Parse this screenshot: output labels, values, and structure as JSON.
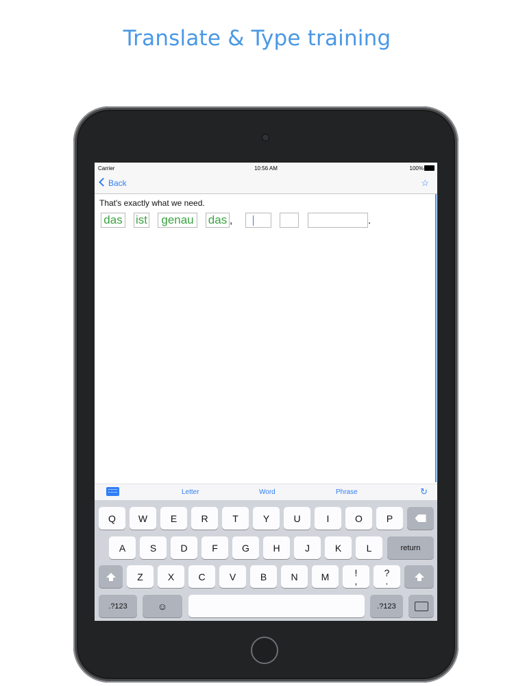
{
  "headline": "Translate & Type training",
  "status_bar": {
    "carrier": "Carrier",
    "time": "10:56 AM",
    "battery": "100%"
  },
  "nav": {
    "back_label": "Back",
    "star_icon": "star-icon"
  },
  "exercise": {
    "sentence": "That's exactly what we need.",
    "answered_words": [
      "das",
      "ist",
      "genau",
      "das"
    ],
    "comma": ",",
    "period": ".",
    "empty_slots": 3
  },
  "toolbar": {
    "letter": "Letter",
    "word": "Word",
    "phrase": "Phrase"
  },
  "keyboard": {
    "row1": [
      "Q",
      "W",
      "E",
      "R",
      "T",
      "Y",
      "U",
      "I",
      "O",
      "P"
    ],
    "row2": [
      "A",
      "S",
      "D",
      "F",
      "G",
      "H",
      "J",
      "K",
      "L"
    ],
    "return": "return",
    "row3": [
      "Z",
      "X",
      "C",
      "V",
      "B",
      "N",
      "M"
    ],
    "exclaim": "!",
    "comma_key": ",",
    "question": "?",
    "period_key": ".",
    "numbers": ".?123",
    "emoji": "☺"
  },
  "colors": {
    "accent": "#2f7ef6",
    "headline": "#4a98e6",
    "correct": "#3aa341"
  }
}
